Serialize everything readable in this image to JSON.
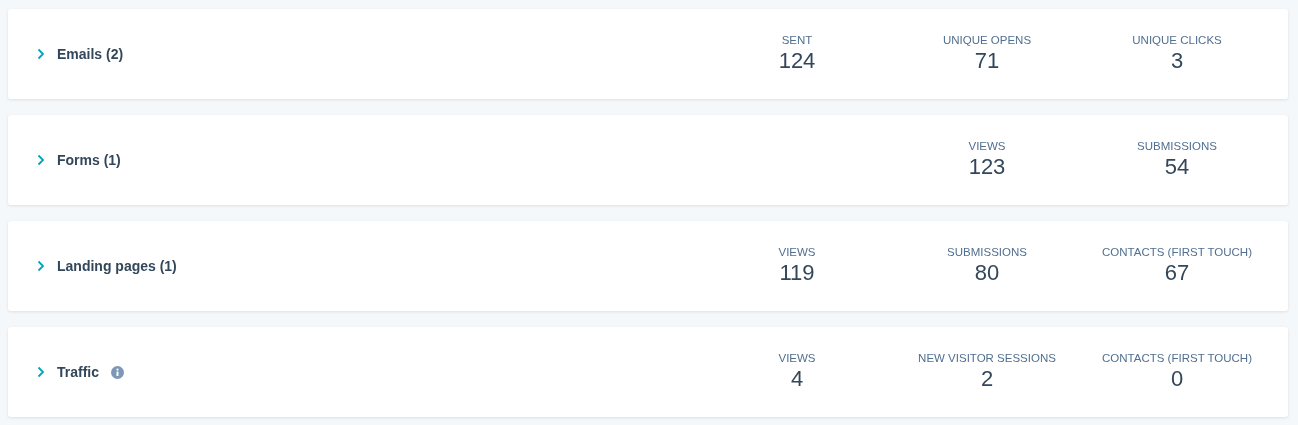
{
  "sections": [
    {
      "title": "Emails (2)",
      "expanded": false,
      "info": false,
      "stats": [
        {
          "label": "SENT",
          "value": "124"
        },
        {
          "label": "UNIQUE OPENS",
          "value": "71"
        },
        {
          "label": "UNIQUE CLICKS",
          "value": "3"
        }
      ]
    },
    {
      "title": "Forms (1)",
      "expanded": false,
      "info": false,
      "stats": [
        {
          "label": "VIEWS",
          "value": "123"
        },
        {
          "label": "SUBMISSIONS",
          "value": "54"
        }
      ]
    },
    {
      "title": "Landing pages (1)",
      "expanded": false,
      "info": false,
      "stats": [
        {
          "label": "VIEWS",
          "value": "119"
        },
        {
          "label": "SUBMISSIONS",
          "value": "80"
        },
        {
          "label": "CONTACTS (FIRST TOUCH)",
          "value": "67"
        }
      ]
    },
    {
      "title": "Traffic",
      "expanded": false,
      "info": true,
      "stats": [
        {
          "label": "VIEWS",
          "value": "4"
        },
        {
          "label": "NEW VISITOR SESSIONS",
          "value": "2"
        },
        {
          "label": "CONTACTS (FIRST TOUCH)",
          "value": "0"
        }
      ]
    }
  ]
}
